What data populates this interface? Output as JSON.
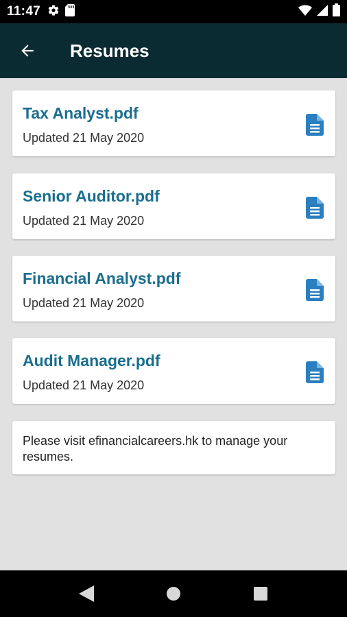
{
  "status_bar": {
    "time": "11:47",
    "icons": [
      "settings-gear-icon",
      "sd-card-icon",
      "wifi-icon",
      "cell-signal-icon",
      "battery-icon"
    ]
  },
  "app_bar": {
    "title": "Resumes",
    "back_icon": "arrow-left-icon"
  },
  "resumes": [
    {
      "title": "Tax Analyst.pdf",
      "updated": "Updated 21 May 2020",
      "icon": "document-icon"
    },
    {
      "title": "Senior Auditor.pdf",
      "updated": "Updated 21 May 2020",
      "icon": "document-icon"
    },
    {
      "title": "Financial Analyst.pdf",
      "updated": "Updated 21 May 2020",
      "icon": "document-icon"
    },
    {
      "title": "Audit Manager.pdf",
      "updated": "Updated 21 May 2020",
      "icon": "document-icon"
    }
  ],
  "info": {
    "text": "Please visit efinancialcareers.hk to manage your resumes."
  },
  "nav_bar": {
    "icons": [
      "back-triangle-icon",
      "home-circle-icon",
      "recents-square-icon"
    ]
  },
  "colors": {
    "app_bar": "#0b2b33",
    "title_text": "#1a6e8e",
    "doc_icon": "#2a7fc0",
    "background": "#e1e1e1"
  }
}
